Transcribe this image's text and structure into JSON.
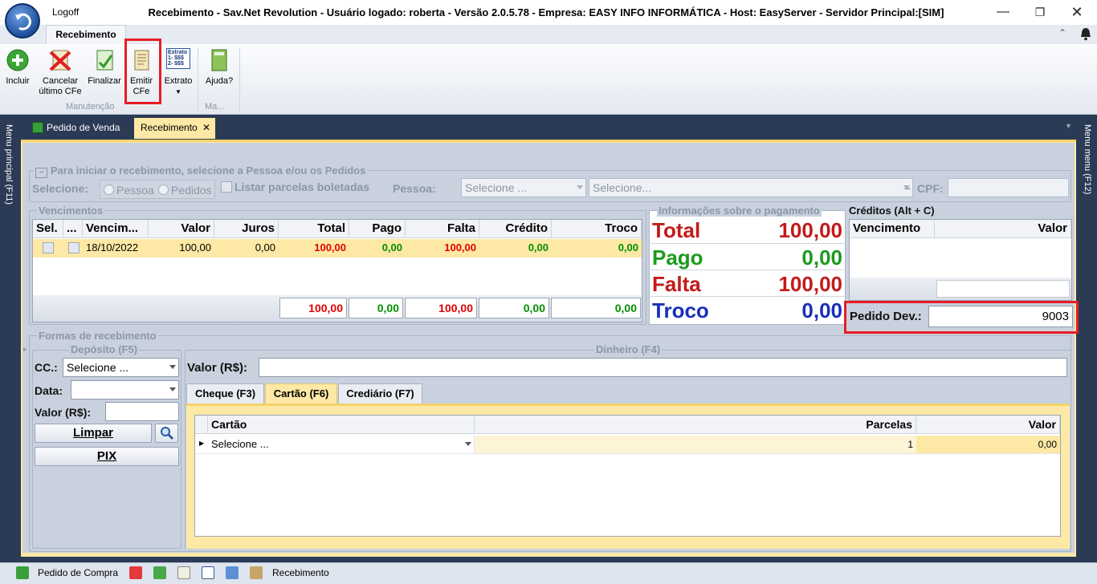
{
  "titlebar": {
    "logoff": "Logoff",
    "title": "Recebimento - Sav.Net Revolution - Usuário logado: roberta - Versão 2.0.5.78 - Empresa: EASY INFO INFORMÁTICA - Host: EasyServer - Servidor Principal:[SIM]"
  },
  "ribbon": {
    "tab": "Recebimento",
    "buttons": [
      {
        "label1": "Incluir",
        "label2": ""
      },
      {
        "label1": "Cancelar",
        "label2": "último CFe"
      },
      {
        "label1": "Finalizar",
        "label2": ""
      },
      {
        "label1": "Emitir",
        "label2": "CFe"
      },
      {
        "label1": "Extrato",
        "label2": ""
      },
      {
        "label1": "Ajuda?",
        "label2": ""
      }
    ],
    "group1": "Manutenção",
    "group2": "Ma...",
    "extrato_icon_title": "Extrato",
    "extrato_icon_l1": "1- $$$",
    "extrato_icon_l2": "2- $$$"
  },
  "side": {
    "left": "Menu principal (F11)",
    "right": "Menu menu (F12)"
  },
  "tabs": {
    "pedido": "Pedido de Venda",
    "recebimento": "Recebimento"
  },
  "iniciar": {
    "legend": "Para iniciar o recebimento, selecione a Pessoa e/ou os Pedidos",
    "selecione": "Selecione:",
    "pessoa_radio": "Pessoa",
    "pedidos_radio": "Pedidos",
    "listar": "Listar parcelas boletadas",
    "pessoa_lbl": "Pessoa:",
    "combo1": "Selecione ...",
    "combo2": "Selecione...",
    "minus": "–",
    "cpf": "CPF:"
  },
  "vencimentos": {
    "legend": "Vencimentos",
    "headers": [
      "Sel.",
      "...",
      "Vencim...",
      "Valor",
      "Juros",
      "Total",
      "Pago",
      "Falta",
      "Crédito",
      "Troco"
    ],
    "row": {
      "venc": "18/10/2022",
      "valor": "100,00",
      "juros": "0,00",
      "total": "100,00",
      "pago": "0,00",
      "falta": "100,00",
      "credito": "0,00",
      "troco": "0,00"
    },
    "totals": {
      "total": "100,00",
      "pago": "0,00",
      "falta": "100,00",
      "credito": "0,00",
      "troco": "0,00"
    }
  },
  "info": {
    "legend": "Informações sobre o pagamento",
    "total_l": "Total",
    "total_v": "100,00",
    "pago_l": "Pago",
    "pago_v": "0,00",
    "falta_l": "Falta",
    "falta_v": "100,00",
    "troco_l": "Troco",
    "troco_v": "0,00"
  },
  "creditos": {
    "legend": "Créditos (Alt + C)",
    "h_venc": "Vencimento",
    "h_valor": "Valor"
  },
  "pedido_dev": {
    "label": "Pedido Dev.:",
    "value": "9003"
  },
  "formas": {
    "legend": "Formas de recebimento",
    "deposito": "Depósito (F5)",
    "cc": "CC.:",
    "cc_value": "Selecione ...",
    "data": "Data:",
    "valor": "Valor (R$):",
    "limpar": "Limpar",
    "pix": "PIX",
    "dinheiro": "Dinheiro (F4)",
    "valor_din": "Valor (R$):",
    "tab_cheque": "Cheque (F3)",
    "tab_cartao": "Cartão (F6)",
    "tab_crediario": "Crediário (F7)",
    "h_cartao": "Cartão",
    "h_parcelas": "Parcelas",
    "h_valor": "Valor",
    "row_cartao": "Selecione ...",
    "row_parcelas": "1",
    "row_valor": "0,00"
  },
  "statusbar": {
    "pedido_compra": "Pedido de Compra",
    "recebimento": "Recebimento"
  },
  "colors": {
    "accent": "#2b3a55",
    "highlight": "#e61d25",
    "row": "#fde9a5"
  }
}
